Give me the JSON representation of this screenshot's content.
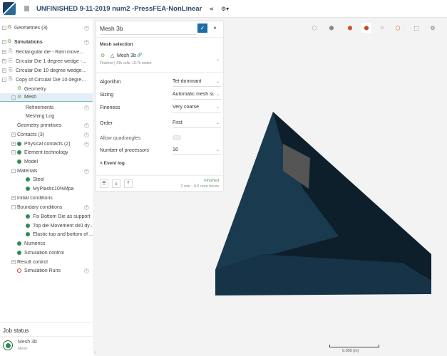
{
  "header": {
    "title": "UNFINISHED 9-11-2019 num2 -PressFEA-NonLinear",
    "share_icon": "share-icon",
    "settings_icon": "gear-icon"
  },
  "tree": [
    {
      "label": "Geometries (3)",
      "level": 0,
      "pm": "-",
      "add": true,
      "icon": "geometry"
    },
    {
      "label": "Simulations",
      "level": 0,
      "pm": "-",
      "add": true,
      "icon": "sim",
      "bold": true
    },
    {
      "label": "Rectangular die - Ram movemen...",
      "level": 1,
      "pm": "+",
      "icon": "file"
    },
    {
      "label": "Circular Die 1 degree wedge - To...",
      "level": 1,
      "pm": "+",
      "icon": "file"
    },
    {
      "label": "Circular Die 10 degree wedge - T...",
      "level": 1,
      "pm": "+",
      "icon": "file"
    },
    {
      "label": "Copy of Circular Die 10 degree ...",
      "level": 1,
      "pm": "-",
      "icon": "file"
    },
    {
      "label": "Geometry",
      "level": 2,
      "icon": "sim"
    },
    {
      "label": "Mesh",
      "level": 2,
      "pm": "-",
      "icon": "sim",
      "selected": true
    },
    {
      "label": "Refinements",
      "level": 3,
      "add": true
    },
    {
      "label": "Meshing Log",
      "level": 3
    },
    {
      "label": "Geometry primitives",
      "level": 2,
      "add": true
    },
    {
      "label": "Contacts (3)",
      "level": 2,
      "pm": "+",
      "add": true
    },
    {
      "label": "Physical contacts (2)",
      "level": 2,
      "pm": "+",
      "add": true,
      "status": "ok"
    },
    {
      "label": "Element technology",
      "level": 2,
      "pm": "+",
      "status": "ok"
    },
    {
      "label": "Model",
      "level": 2,
      "status": "ok"
    },
    {
      "label": "Materials",
      "level": 2,
      "pm": "-",
      "add": true
    },
    {
      "label": "Steel",
      "level": 3,
      "status": "ok"
    },
    {
      "label": "MyPlastic10%Mpa",
      "level": 3,
      "status": "ok"
    },
    {
      "label": "Initial conditions",
      "level": 2,
      "pm": "+"
    },
    {
      "label": "Boundary conditions",
      "level": 2,
      "pm": "-",
      "add": true
    },
    {
      "label": "Fix Bottom Die as support",
      "level": 3,
      "status": "ok"
    },
    {
      "label": "Top die Movement dx0 dy...",
      "level": 3,
      "status": "ok"
    },
    {
      "label": "Elastic top and bottom of ...",
      "level": 3,
      "status": "ok"
    },
    {
      "label": "Numerics",
      "level": 2,
      "status": "ok"
    },
    {
      "label": "Simulation control",
      "level": 2,
      "status": "ok"
    },
    {
      "label": "Result control",
      "level": 2,
      "pm": "+"
    },
    {
      "label": "Simulation Runs",
      "level": 2,
      "status": "err",
      "add": true
    }
  ],
  "job_status": {
    "title": "Job status",
    "name": "Mesh 3b",
    "type": "Mesh"
  },
  "mesh_panel": {
    "name": "Mesh 3b",
    "selection_title": "Mesh selection",
    "mesh_name": "Mesh 3b",
    "mesh_info": "Finished | 41k cells, 10.7k nodes",
    "fields": [
      {
        "label": "Algorithm",
        "value": "Tet-dominant"
      },
      {
        "label": "Sizing",
        "value": "Automatic mesh sizing"
      },
      {
        "label": "Fineness",
        "value": "Very coarse"
      },
      {
        "label": "Order",
        "value": "First"
      },
      {
        "label": "Number of processors",
        "value": "16"
      }
    ],
    "allow_quadrangles": {
      "label": "Allow quadrangles",
      "on": false
    },
    "event_log": "Event log",
    "status": "Finished",
    "duration": "2 min - 0.5 core hours"
  },
  "toolbar": [
    "cube-outline-icon",
    "cube-solid-icon",
    "cube-orange-icon",
    "cube-selected-icon",
    "cube-vertices-icon",
    "cube-faces-icon",
    "box-select-icon",
    "settings-sliders-icon"
  ],
  "scale_bar": "0.005 [m]",
  "colors": {
    "accent": "#1c6fa5",
    "ok": "#2e8b57",
    "finished": "#3a9a3a",
    "mesh_dark": "#0d1f2b",
    "mesh_face": "#1a3a4f"
  }
}
